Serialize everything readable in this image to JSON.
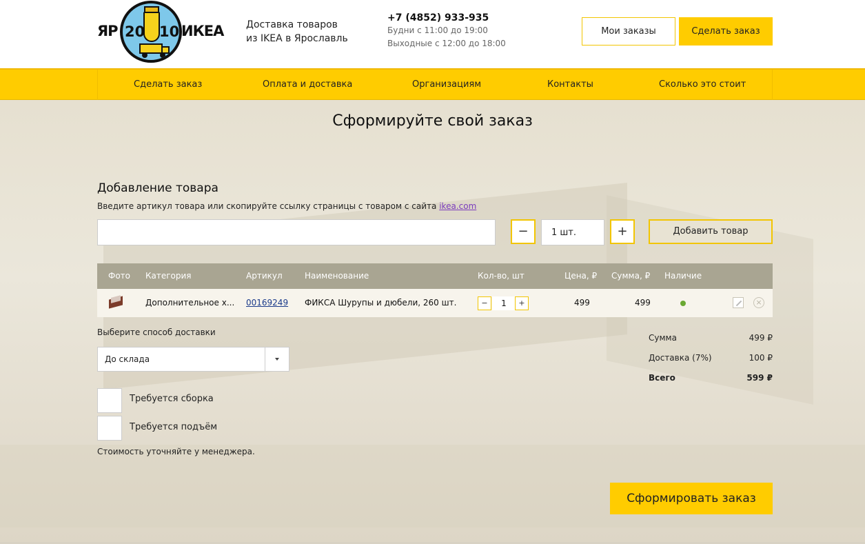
{
  "header": {
    "logo_left": "ЯР",
    "logo_num1": "20",
    "logo_num2": "10",
    "logo_right": "ИКЕА",
    "tagline_line1": "Доставка товаров",
    "tagline_line2": "из IKEA в Ярославль",
    "phone": "+7 (4852) 933-935",
    "hours_weekdays": "Будни с 11:00 до 19:00",
    "hours_weekend": "Выходные с 12:00 до 18:00",
    "my_orders_label": "Мои заказы",
    "make_order_label": "Сделать заказ"
  },
  "nav": {
    "items": [
      "Сделать заказ",
      "Оплата и доставка",
      "Организациям",
      "Контакты",
      "Сколько это стоит"
    ]
  },
  "page": {
    "title": "Сформируйте свой заказ"
  },
  "add_item": {
    "title": "Добавление товара",
    "hint_text": "Введите артикул товара или скопируйте ссылку страницы с товаром с сайта ",
    "hint_link": "ikea.com",
    "article_placeholder": "",
    "minus": "−",
    "qty_value": "1 шт.",
    "plus": "+",
    "add_button_label": "Добавить товар"
  },
  "table": {
    "headers": [
      "Фото",
      "Категория",
      "Артикул",
      "Наименование",
      "Кол-во, шт",
      "Цена, ₽",
      "Сумма, ₽",
      "Наличие"
    ],
    "rows": [
      {
        "category": "Дополнительное х...",
        "article": "00169249",
        "name": "ФИКСА Шурупы и дюбели, 260 шт.",
        "qty_minus": "−",
        "qty": "1",
        "qty_plus": "+",
        "price": "499",
        "sum": "499",
        "close_glyph": "×"
      }
    ]
  },
  "delivery": {
    "label": "Выберите способ доставки",
    "selected": "До склада"
  },
  "options": {
    "assembly": "Требуется сборка",
    "lifting": "Требуется подъём",
    "note": "Стоимость уточняйте у менеджера."
  },
  "summary": {
    "sum_label": "Сумма",
    "sum_value": "499 ₽",
    "delivery_label": "Доставка (7%)",
    "delivery_value": "100 ₽",
    "total_label": "Всего",
    "total_value": "599 ₽"
  },
  "submit_label": "Сформировать заказ",
  "colors": {
    "accent": "#ffcc00",
    "table_header": "#a9a592",
    "status_ok": "#6aa832"
  }
}
